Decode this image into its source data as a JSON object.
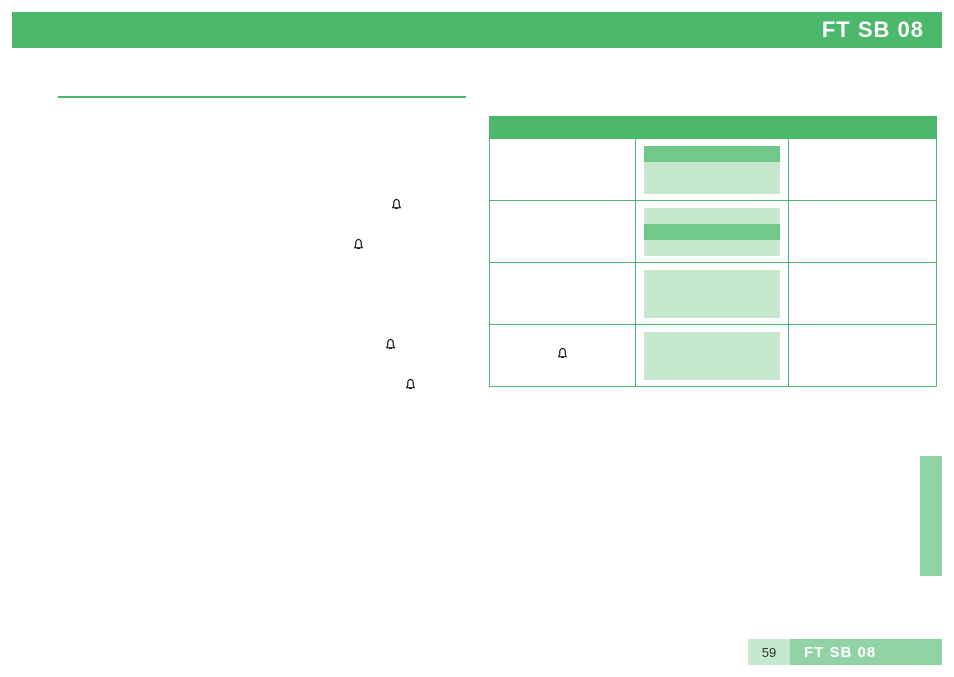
{
  "header": {
    "title": "FT SB 08"
  },
  "left": {
    "icons": [
      "bell",
      "bell",
      "bell",
      "bell"
    ]
  },
  "table": {
    "rows": [
      {
        "col1_icon": "",
        "swatches": [
          "dark",
          "light",
          "light"
        ]
      },
      {
        "col1_icon": "",
        "swatches": [
          "light",
          "dark",
          "light"
        ]
      },
      {
        "col1_icon": "",
        "swatches": [
          "light",
          "light",
          "light"
        ]
      },
      {
        "col1_icon": "bell",
        "swatches": [
          "light",
          "light",
          "light"
        ]
      }
    ]
  },
  "footer": {
    "page_number": "59",
    "label": "FT SB 08"
  }
}
